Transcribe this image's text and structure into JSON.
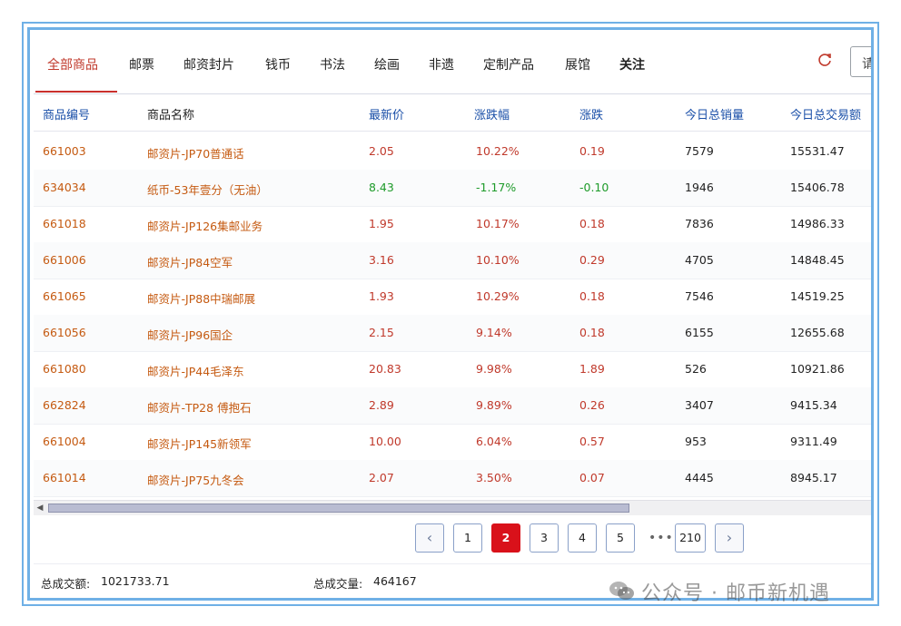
{
  "tabs": [
    {
      "label": "全部商品",
      "active": true
    },
    {
      "label": "邮票"
    },
    {
      "label": "邮资封片"
    },
    {
      "label": "钱币"
    },
    {
      "label": "书法"
    },
    {
      "label": "绘画"
    },
    {
      "label": "非遗"
    },
    {
      "label": "定制产品"
    },
    {
      "label": "展馆"
    },
    {
      "label": "关注"
    }
  ],
  "search": {
    "label": "请"
  },
  "columns": [
    "商品编号",
    "商品名称",
    "最新价",
    "涨跌幅",
    "涨跌",
    "今日总销量",
    "今日总交易额"
  ],
  "rows": [
    {
      "code": "661003",
      "name": "邮资片-JP70普通话",
      "price": "2.05",
      "pct": "10.22%",
      "chg": "0.19",
      "volume": "7579",
      "amount": "15531.47",
      "dir": "up"
    },
    {
      "code": "634034",
      "name": "纸币-53年壹分（无油）",
      "price": "8.43",
      "pct": "-1.17%",
      "chg": "-0.10",
      "volume": "1946",
      "amount": "15406.78",
      "dir": "down"
    },
    {
      "code": "661018",
      "name": "邮资片-JP126集邮业务",
      "price": "1.95",
      "pct": "10.17%",
      "chg": "0.18",
      "volume": "7836",
      "amount": "14986.33",
      "dir": "up"
    },
    {
      "code": "661006",
      "name": "邮资片-JP84空军",
      "price": "3.16",
      "pct": "10.10%",
      "chg": "0.29",
      "volume": "4705",
      "amount": "14848.45",
      "dir": "up"
    },
    {
      "code": "661065",
      "name": "邮资片-JP88中瑞邮展",
      "price": "1.93",
      "pct": "10.29%",
      "chg": "0.18",
      "volume": "7546",
      "amount": "14519.25",
      "dir": "up"
    },
    {
      "code": "661056",
      "name": "邮资片-JP96国企",
      "price": "2.15",
      "pct": "9.14%",
      "chg": "0.18",
      "volume": "6155",
      "amount": "12655.68",
      "dir": "up"
    },
    {
      "code": "661080",
      "name": "邮资片-JP44毛泽东",
      "price": "20.83",
      "pct": "9.98%",
      "chg": "1.89",
      "volume": "526",
      "amount": "10921.86",
      "dir": "up"
    },
    {
      "code": "662824",
      "name": "邮资片-TP28 傅抱石",
      "price": "2.89",
      "pct": "9.89%",
      "chg": "0.26",
      "volume": "3407",
      "amount": "9415.34",
      "dir": "up"
    },
    {
      "code": "661004",
      "name": "邮资片-JP145新领军",
      "price": "10.00",
      "pct": "6.04%",
      "chg": "0.57",
      "volume": "953",
      "amount": "9311.49",
      "dir": "up"
    },
    {
      "code": "661014",
      "name": "邮资片-JP75九冬会",
      "price": "2.07",
      "pct": "3.50%",
      "chg": "0.07",
      "volume": "4445",
      "amount": "8945.17",
      "dir": "up"
    }
  ],
  "pagination": {
    "prev": "‹",
    "pages": [
      "1",
      "2",
      "3",
      "4",
      "5"
    ],
    "current": "2",
    "ellipsis": "•••",
    "last": "210",
    "next": "›"
  },
  "footer": {
    "total_amount_label": "总成交额:",
    "total_amount": "1021733.71",
    "total_volume_label": "总成交量:",
    "total_volume": "464167"
  },
  "watermark": {
    "text": "公众号 · 邮币新机遇"
  },
  "colors": {
    "accent_red": "#d9111a",
    "up": "#c0392b",
    "down": "#1e9b2a",
    "header_blue": "#1a4fa8",
    "frame_blue": "#6fb0e6"
  }
}
